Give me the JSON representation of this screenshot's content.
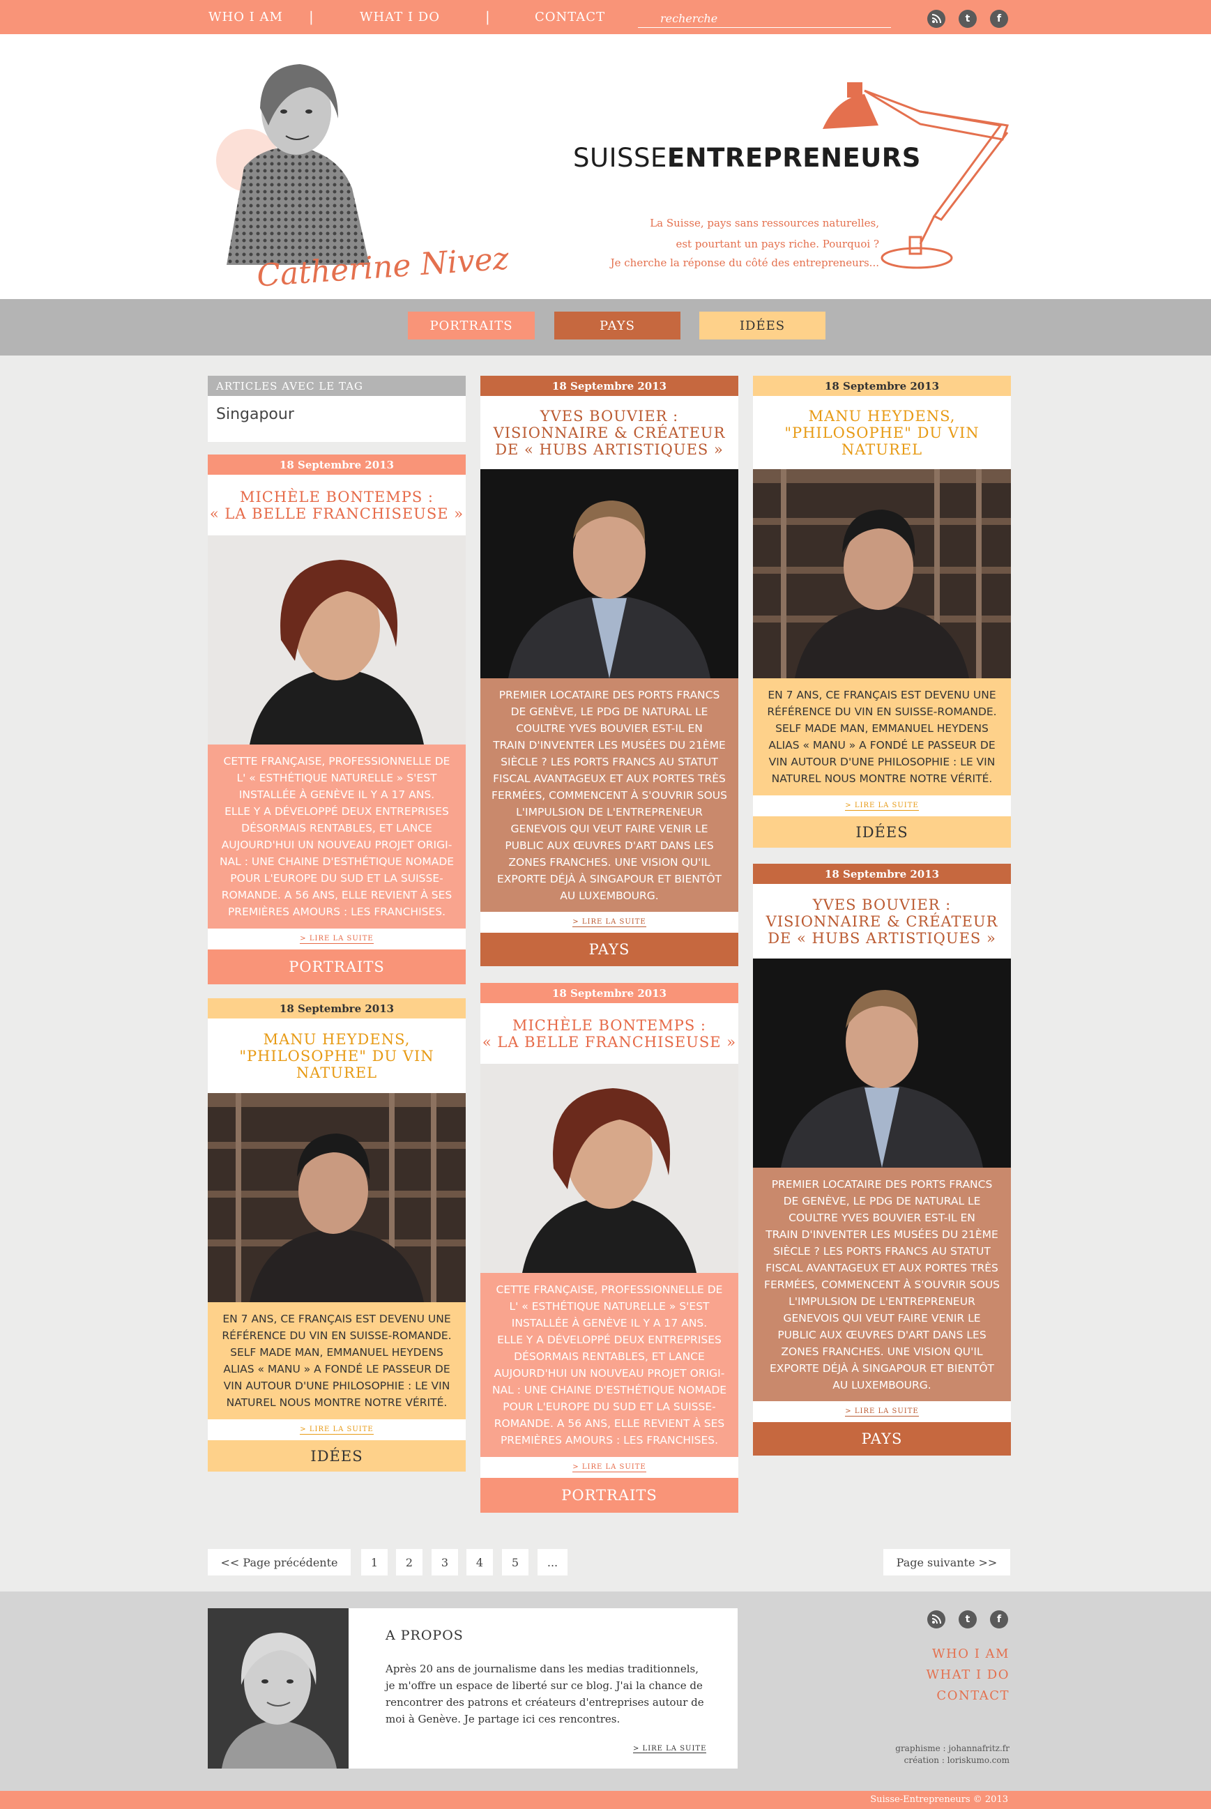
{
  "topbar": {
    "nav": [
      "WHO I AM",
      "WHAT I DO",
      "CONTACT"
    ],
    "separators": [
      "|",
      "|"
    ],
    "search_placeholder": "recherche",
    "social": [
      {
        "icon": "rss-icon",
        "glyph": "ʃ"
      },
      {
        "icon": "twitter-icon",
        "glyph": "t"
      },
      {
        "icon": "facebook-icon",
        "glyph": "f"
      }
    ]
  },
  "header": {
    "logo_light": "SUISSE",
    "logo_bold": "ENTREPRENEURS",
    "tagline": [
      "La Suisse, pays sans ressources naturelles,",
      "est pourtant un pays riche. Pourquoi ?",
      "Je cherche la réponse du côté des entrepreneurs..."
    ],
    "signature": "Catherine Nivez"
  },
  "categories": [
    "PORTRAITS",
    "PAYS",
    "IDÉES"
  ],
  "tag_box": {
    "label": "ARTICLES AVEC LE TAG",
    "value": "Singapour"
  },
  "articles": {
    "a1": {
      "date": "18 Septembre 2013",
      "title": [
        "MICHÈLE BONTEMPS :",
        "« LA BELLE FRANCHISEUSE »"
      ],
      "body": [
        "CETTE FRANÇAISE, PROFESSIONNELLE DE",
        "L' « ESTHÉTIQUE NATURELLE » S'EST",
        "INSTALLÉE À GENÈVE IL Y A 17 ANS.",
        "ELLE Y A DÉVELOPPÉ DEUX ENTREPRISES",
        "DÉSORMAIS RENTABLES, ET LANCE",
        "AUJOURD'HUI UN NOUVEAU PROJET ORIGI-",
        "NAL : UNE CHAINE D'ESTHÉTIQUE NOMADE",
        "POUR L'EUROPE DU SUD ET LA SUISSE-",
        "ROMANDE. A 56 ANS, ELLE REVIENT À SES",
        "PREMIÈRES AMOURS : LES FRANCHISES."
      ],
      "more": "> LIRE LA SUITE",
      "category": "PORTRAITS"
    },
    "a2": {
      "date": "18 Septembre 2013",
      "title": [
        "MANU HEYDENS,",
        "\"PHILOSOPHE\" DU VIN",
        "NATUREL"
      ],
      "body": [
        "EN 7 ANS, CE FRANÇAIS EST DEVENU UNE",
        "RÉFÉRENCE DU VIN EN SUISSE-ROMANDE.",
        "SELF MADE MAN, EMMANUEL HEYDENS",
        "ALIAS « MANU » A FONDÉ LE PASSEUR DE",
        "VIN AUTOUR D'UNE PHILOSOPHIE : LE VIN",
        "NATUREL NOUS MONTRE NOTRE VÉRITÉ."
      ],
      "more": "> LIRE LA SUITE",
      "category": "IDÉES"
    },
    "a3": {
      "date": "18 Septembre 2013",
      "title": [
        "YVES BOUVIER :",
        "VISIONNAIRE & CRÉATEUR",
        "DE « HUBS ARTISTIQUES »"
      ],
      "body": [
        "PREMIER LOCATAIRE DES PORTS FRANCS",
        "DE GENÈVE, LE PDG DE NATURAL LE",
        "COULTRE YVES BOUVIER EST-IL EN",
        "TRAIN D'INVENTER LES MUSÉES DU 21ÈME",
        "SIÈCLE ? LES PORTS FRANCS AU STATUT",
        "FISCAL AVANTAGEUX ET AUX PORTES TRÈS",
        "FERMÉES, COMMENCENT À S'OUVRIR SOUS",
        "L'IMPULSION DE L'ENTREPRENEUR",
        "GENEVOIS QUI VEUT FAIRE VENIR LE",
        "PUBLIC AUX ŒUVRES D'ART DANS LES",
        "ZONES FRANCHES. UNE VISION QU'IL",
        "EXPORTE DÉJÀ À SINGAPOUR ET BIENTÔT",
        "AU LUXEMBOURG."
      ],
      "more": "> LIRE LA SUITE",
      "category": "PAYS"
    },
    "a4": {
      "date": "18 Septembre 2013",
      "title": [
        "MICHÈLE BONTEMPS :",
        "« LA BELLE FRANCHISEUSE »"
      ],
      "body": [
        "CETTE FRANÇAISE, PROFESSIONNELLE DE",
        "L' « ESTHÉTIQUE NATURELLE » S'EST",
        "INSTALLÉE À GENÈVE IL Y A 17 ANS.",
        "ELLE Y A DÉVELOPPÉ DEUX ENTREPRISES",
        "DÉSORMAIS RENTABLES, ET LANCE",
        "AUJOURD'HUI UN NOUVEAU PROJET ORIGI-",
        "NAL : UNE CHAINE D'ESTHÉTIQUE NOMADE",
        "POUR L'EUROPE DU SUD ET LA SUISSE-",
        "ROMANDE. A 56 ANS, ELLE REVIENT À SES",
        "PREMIÈRES AMOURS : LES FRANCHISES."
      ],
      "more": "> LIRE LA SUITE",
      "category": "PORTRAITS"
    },
    "a5": {
      "date": "18 Septembre 2013",
      "title": [
        "MANU HEYDENS,",
        "\"PHILOSOPHE\" DU VIN",
        "NATUREL"
      ],
      "body": [
        "EN 7 ANS, CE FRANÇAIS EST DEVENU UNE",
        "RÉFÉRENCE DU VIN EN SUISSE-ROMANDE.",
        "SELF MADE MAN, EMMANUEL HEYDENS",
        "ALIAS « MANU » A FONDÉ LE PASSEUR DE",
        "VIN AUTOUR D'UNE PHILOSOPHIE : LE VIN",
        "NATUREL NOUS MONTRE NOTRE VÉRITÉ."
      ],
      "more": "> LIRE LA SUITE",
      "category": "IDÉES"
    },
    "a6": {
      "date": "18 Septembre 2013",
      "title": [
        "YVES BOUVIER :",
        "VISIONNAIRE & CRÉATEUR",
        "DE « HUBS ARTISTIQUES »"
      ],
      "body": [
        "PREMIER LOCATAIRE DES PORTS FRANCS",
        "DE GENÈVE, LE PDG DE NATURAL LE",
        "COULTRE YVES BOUVIER EST-IL EN",
        "TRAIN D'INVENTER LES MUSÉES DU 21ÈME",
        "SIÈCLE ? LES PORTS FRANCS AU STATUT",
        "FISCAL AVANTAGEUX ET AUX PORTES TRÈS",
        "FERMÉES, COMMENCENT À S'OUVRIR SOUS",
        "L'IMPULSION DE L'ENTREPRENEUR",
        "GENEVOIS QUI VEUT FAIRE VENIR LE",
        "PUBLIC AUX ŒUVRES D'ART DANS LES",
        "ZONES FRANCHES. UNE VISION QU'IL",
        "EXPORTE DÉJÀ À SINGAPOUR ET BIENTÔT",
        "AU LUXEMBOURG."
      ],
      "more": "> LIRE LA SUITE",
      "category": "PAYS"
    }
  },
  "pagination": {
    "prev": "<< Page précédente",
    "pages": [
      "1",
      "2",
      "3",
      "4",
      "5",
      "..."
    ],
    "next": "Page suivante >>"
  },
  "footer": {
    "about_title": "A PROPOS",
    "about_text": [
      "Après 20 ans de journalisme dans les medias traditionnels,",
      "je m'offre un espace de liberté sur ce blog. J'ai la chance de",
      "rencontrer des patrons et créateurs d'entreprises autour de",
      "moi à Genève. Je partage ici ces rencontres."
    ],
    "about_more": "> LIRE LA SUITE",
    "links": [
      "WHO I AM",
      "WHAT I DO",
      "CONTACT"
    ],
    "credits": [
      "graphisme : johannafritz.fr",
      "création : loriskumo.com"
    ],
    "copyright": "Suisse-Entrepreneurs © 2013"
  },
  "colors": {
    "salmon": "#f99478",
    "rust": "#c6683f",
    "peach": "#fed18a",
    "grey": "#b4b4b4"
  }
}
